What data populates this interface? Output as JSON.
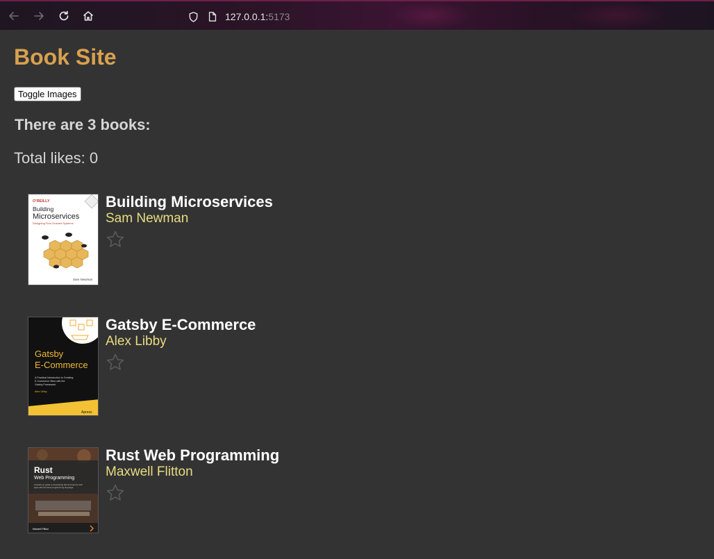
{
  "browser": {
    "url_host": "127.0.0.1:",
    "url_port": "5173"
  },
  "page": {
    "title": "Book Site",
    "toggle_label": "Toggle Images",
    "count_heading": "There are 3 books:",
    "total_likes": "Total likes: 0"
  },
  "books": [
    {
      "title": "Building Microservices",
      "author": "Sam Newman",
      "liked": false,
      "cover": {
        "publisher": "O'REILLY",
        "line1": "Building",
        "line2": "Microservices",
        "subtitle": "Designing Fine-Grained Systems",
        "author": "Sam Newman",
        "edition": "Second Edition"
      }
    },
    {
      "title": "Gatsby E-Commerce",
      "author": "Alex Libby",
      "liked": false,
      "cover": {
        "line1": "Gatsby",
        "line2": "E-Commerce",
        "subtitle": "A Practical Introduction to Creating E-Commerce Sites with the Gatsby Framework",
        "author": "Alex Libby",
        "publisher": "Apress"
      }
    },
    {
      "title": "Rust Web Programming",
      "author": "Maxwell Flitton",
      "liked": false,
      "cover": {
        "line1": "Rust",
        "line2": "Web Programming",
        "subtitle": "A hands-on guide to developing fast and secure web apps with the Rust programming language",
        "author": "Maxwell Flitton"
      }
    }
  ],
  "colors": {
    "background": "#333333",
    "title": "#d8a14f",
    "author": "#e8dc82"
  }
}
